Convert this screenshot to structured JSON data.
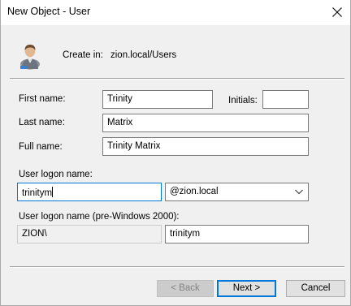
{
  "window": {
    "title": "New Object - User",
    "close_icon": "close-icon"
  },
  "header": {
    "icon": "user-icon",
    "create_in_label": "Create in:",
    "create_in_value": "zion.local/Users"
  },
  "form": {
    "first_name_label": "First name:",
    "first_name_value": "Trinity",
    "initials_label": "Initials:",
    "initials_value": "",
    "last_name_label": "Last name:",
    "last_name_value": "Matrix",
    "full_name_label": "Full name:",
    "full_name_value": "Trinity Matrix",
    "logon_name_label": "User logon name:",
    "logon_name_value": "trinitym",
    "domain_suffix_value": "@zion.local",
    "pre2000_label": "User logon name (pre-Windows 2000):",
    "pre2000_domain_value": "ZION\\",
    "pre2000_name_value": "trinitym"
  },
  "buttons": {
    "back_label": "< Back",
    "next_label": "Next >",
    "cancel_label": "Cancel"
  },
  "colors": {
    "focus_accent": "#0078d7",
    "dialog_background": "#f0f0f0"
  }
}
